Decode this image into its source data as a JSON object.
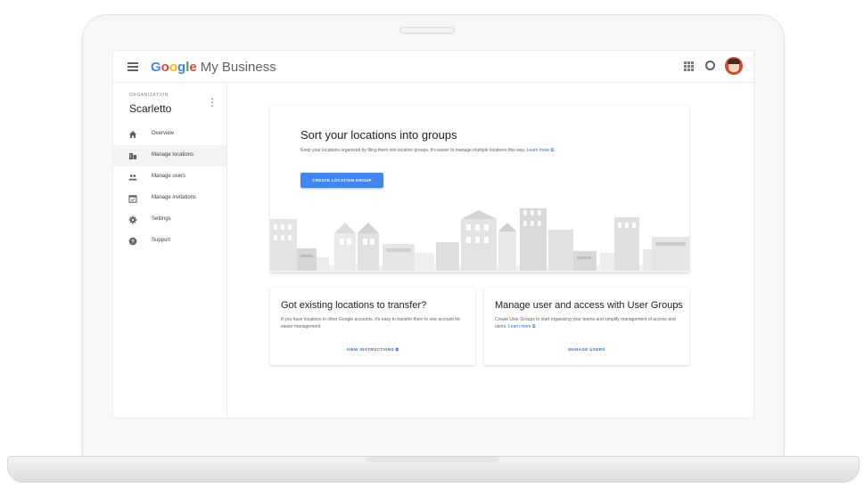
{
  "header": {
    "brand_google": "Google",
    "brand_product": "My Business",
    "brand_colors": [
      "#4285f4",
      "#ea4335",
      "#fbbc05",
      "#4285f4",
      "#34a853",
      "#ea4335"
    ]
  },
  "sidebar": {
    "org_label": "ORGANIZATION",
    "org_name": "Scarletto",
    "items": [
      {
        "label": "Overview",
        "icon": "home-icon"
      },
      {
        "label": "Manage locations",
        "icon": "buildings-icon",
        "active": true
      },
      {
        "label": "Manage users",
        "icon": "users-icon"
      },
      {
        "label": "Manage invitations",
        "icon": "calendar-icon"
      },
      {
        "label": "Settings",
        "icon": "gear-icon"
      },
      {
        "label": "Support",
        "icon": "help-icon"
      }
    ]
  },
  "hero": {
    "title": "Sort your locations into groups",
    "description": "Keep your locations organized by filing them into location groups. It's easier to manage multiple locations this way.",
    "link": "Learn more",
    "button": "CREATE LOCATION GROUP"
  },
  "cards": [
    {
      "title": "Got existing locations to transfer?",
      "description": "If you have locations in other Google accounts, it's easy to transfer them to one account for easier management.",
      "link": "",
      "action": "VIEW INSTRUCTIONS"
    },
    {
      "title": "Manage user and access with User Groups",
      "description": "Create User Groups to start organizing your teams and simplify management of access and users.",
      "link": "Learn more",
      "action": "MANAGE USERS"
    }
  ],
  "colors": {
    "accent": "#4285f4",
    "link": "#1a73e8",
    "avatar": "#d9472b"
  }
}
